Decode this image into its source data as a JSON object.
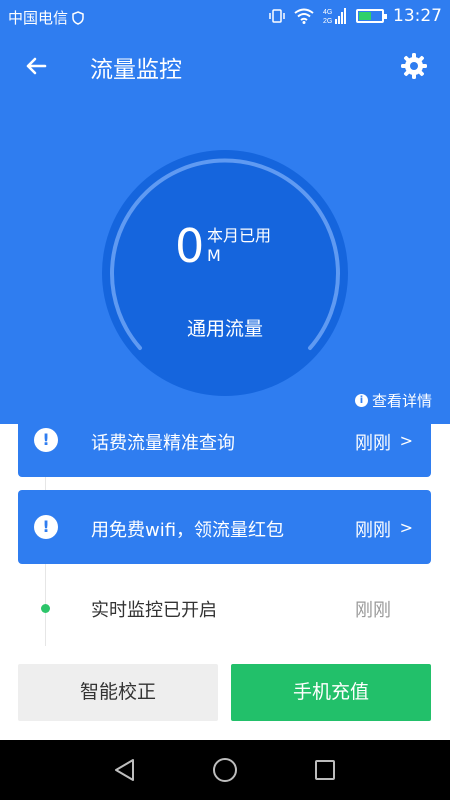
{
  "status_bar": {
    "carrier": "中国电信",
    "network_badge_1": "4G",
    "network_badge_2": "2G",
    "time": "13:27",
    "battery_level": 0.55
  },
  "app_bar": {
    "title": "流量监控",
    "back_icon": "arrow-left-icon",
    "settings_icon": "gear-icon"
  },
  "usage": {
    "value": "0",
    "label": "本月已用",
    "unit": "M",
    "caption": "通用流量",
    "details_label": "查看详情"
  },
  "cards": [
    {
      "text": "话费流量精准查询",
      "time": "刚刚",
      "chevron": ">"
    },
    {
      "text": "用免费wifi，领流量红包",
      "time": "刚刚",
      "chevron": ">"
    }
  ],
  "monitor": {
    "text": "实时监控已开启",
    "time": "刚刚"
  },
  "buttons": {
    "calibrate": "智能校正",
    "recharge": "手机充值"
  },
  "colors": {
    "primary": "#2f7df0",
    "gauge": "#1565dd",
    "accent_green": "#22c06a"
  }
}
